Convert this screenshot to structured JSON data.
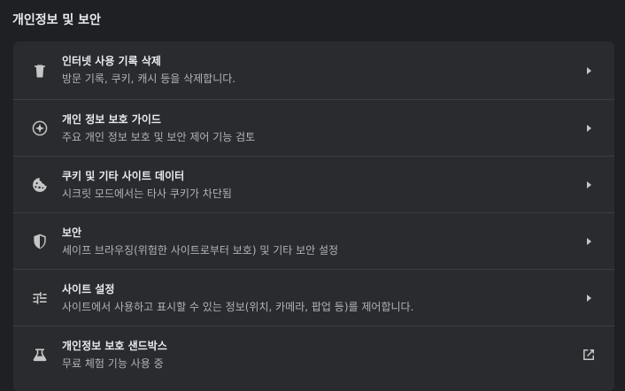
{
  "section_title": "개인정보 및 보안",
  "rows": [
    {
      "title": "인터넷 사용 기록 삭제",
      "subtitle": "방문 기록, 쿠키, 캐시 등을 삭제합니다.",
      "icon": "trash-icon",
      "action": "chevron-right-icon"
    },
    {
      "title": "개인 정보 보호 가이드",
      "subtitle": "주요 개인 정보 보호 및 보안 제어 기능 검토",
      "icon": "compass-icon",
      "action": "chevron-right-icon"
    },
    {
      "title": "쿠키 및 기타 사이트 데이터",
      "subtitle": "시크릿 모드에서는 타사 쿠키가 차단됨",
      "icon": "cookie-icon",
      "action": "chevron-right-icon"
    },
    {
      "title": "보안",
      "subtitle": "세이프 브라우징(위험한 사이트로부터 보호) 및 기타 보안 설정",
      "icon": "shield-icon",
      "action": "chevron-right-icon"
    },
    {
      "title": "사이트 설정",
      "subtitle": "사이트에서 사용하고 표시할 수 있는 정보(위치, 카메라, 팝업 등)를 제어합니다.",
      "icon": "tune-icon",
      "action": "chevron-right-icon"
    },
    {
      "title": "개인정보 보호 샌드박스",
      "subtitle": "무료 체험 기능 사용 중",
      "icon": "flask-icon",
      "action": "open-in-new-icon"
    }
  ]
}
